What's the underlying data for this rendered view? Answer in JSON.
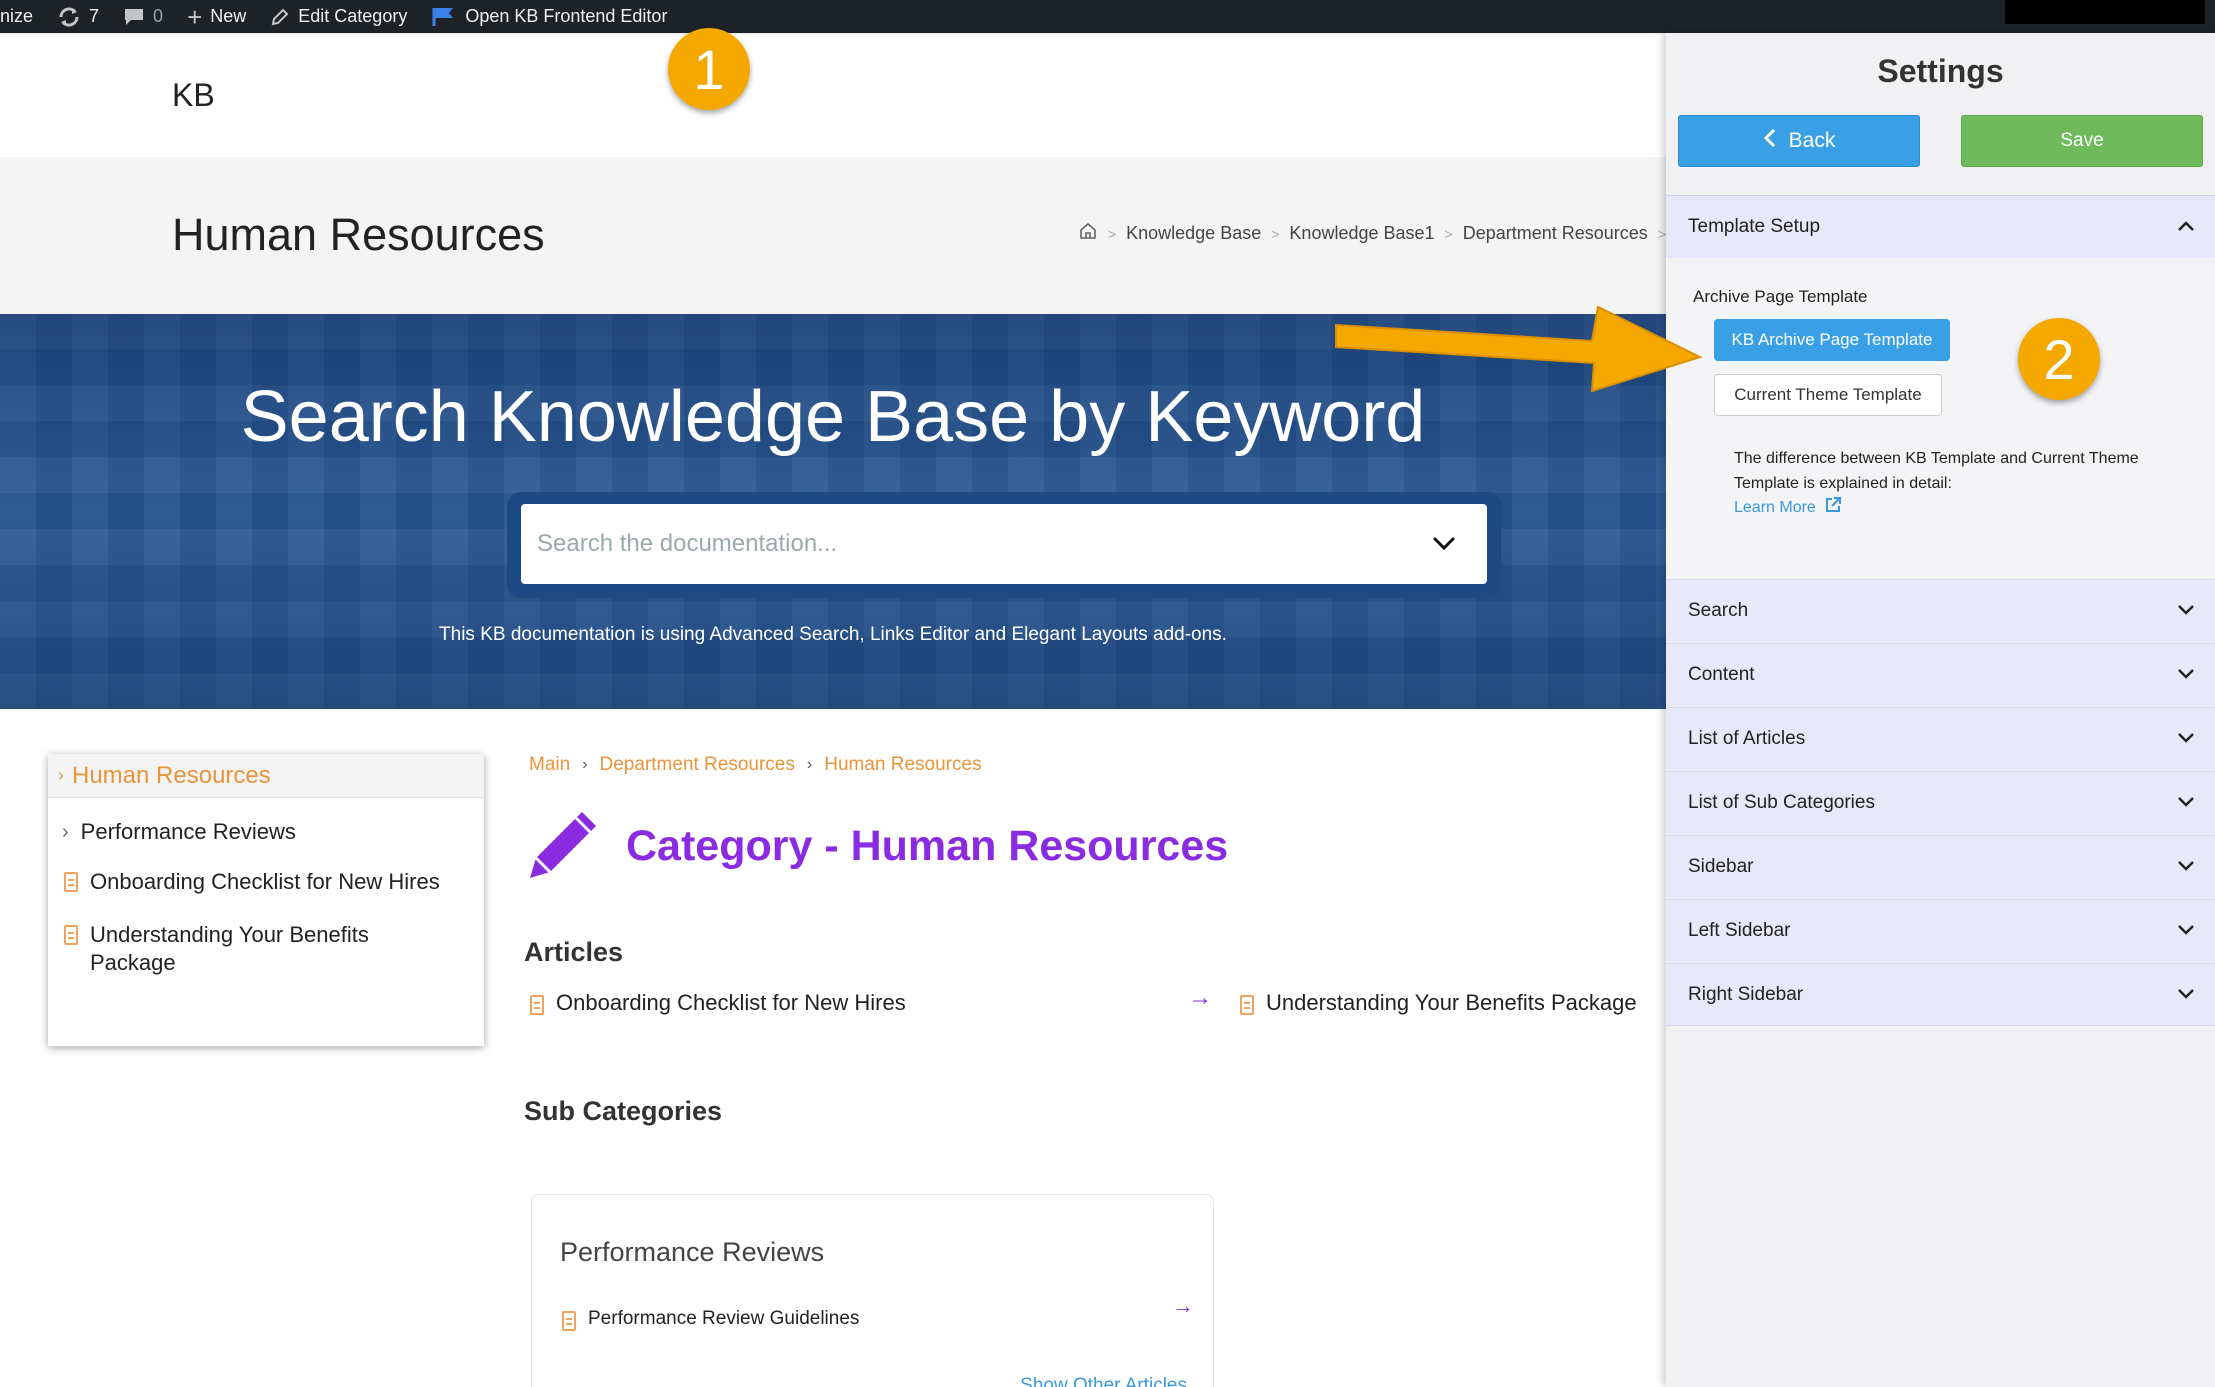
{
  "adminbar": {
    "customize": "nize",
    "updates_count": "7",
    "comments_count": "0",
    "new_label": "New",
    "edit_label": "Edit Category",
    "frontend_label": "Open KB Frontend Editor"
  },
  "site": {
    "logo_text": "KB",
    "page_title": "Human Resources",
    "breadcrumb": [
      "Knowledge Base",
      "Knowledge Base1",
      "Department Resources"
    ]
  },
  "hero": {
    "heading": "Search Knowledge Base by Keyword",
    "search_placeholder": "Search the documentation...",
    "note": "This KB documentation is using Advanced Search, Links Editor and Elegant Layouts add-ons."
  },
  "sidenav": {
    "title": "Human Resources",
    "sub_item": "Performance Reviews",
    "articles": [
      "Onboarding Checklist for New Hires",
      "Understanding Your Benefits\nPackage"
    ]
  },
  "main": {
    "breadcrumb": [
      "Main",
      "Department Resources",
      "Human Resources"
    ],
    "category_title": "Category - Human Resources",
    "articles_heading": "Articles",
    "articles": [
      "Onboarding Checklist for New Hires",
      "Understanding Your Benefits Package"
    ],
    "subcat_heading": "Sub Categories",
    "subcat": {
      "title": "Performance Reviews",
      "article": "Performance Review Guidelines",
      "show_more": "Show Other Articles"
    }
  },
  "settings": {
    "title": "Settings",
    "back_label": "Back",
    "save_label": "Save",
    "template_setup": "Template Setup",
    "archive_label": "Archive Page Template",
    "kb_template": "KB Archive Page Template",
    "theme_template": "Current Theme Template",
    "explain": "The difference between KB Template and Current Theme Template is explained in detail:",
    "learn_more": "Learn More",
    "sections": [
      "Search",
      "Content",
      "List of Articles",
      "List of Sub Categories",
      "Sidebar",
      "Left Sidebar",
      "Right Sidebar"
    ]
  },
  "annotations": {
    "badge1": "1",
    "badge2": "2"
  },
  "colors": {
    "accent_orange": "#e8943a",
    "category_purple": "#8a2be2",
    "back_blue": "#3aa0e6",
    "save_green": "#6fba5d",
    "badge": "#f5a800"
  }
}
